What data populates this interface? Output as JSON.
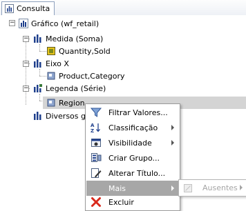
{
  "tab": {
    "label": "Consulta"
  },
  "tree": {
    "root": "Gráfico (wf_retail)",
    "measure_group": "Medida (Soma)",
    "measure_field": "Quantity,Sold",
    "xaxis_group": "Eixo X",
    "xaxis_field": "Product,Category",
    "legend_group": "Legenda (Série)",
    "legend_field": "Region",
    "misc_group": "Diversos gráficos"
  },
  "context_menu": {
    "items": [
      {
        "label": "Filtrar Valores...",
        "icon": "funnel-icon"
      },
      {
        "label": "Classificação",
        "icon": "sort-az-icon",
        "submenu": true
      },
      {
        "label": "Visibilidade",
        "icon": "visibility-icon",
        "submenu": true
      },
      {
        "label": "Criar Grupo...",
        "icon": "group-icon"
      },
      {
        "label": "Alterar Título...",
        "icon": "edit-title-icon"
      },
      {
        "label": "Mais",
        "submenu": true
      },
      {
        "label": "Excluir",
        "icon": "delete-x-icon"
      }
    ]
  },
  "submenu": {
    "label": "Ausentes"
  },
  "colors": {
    "highlight": "#d4d4d4",
    "menu_selected": "#a7a7a7",
    "delete": "#d9281a",
    "chart_blue": "#1e3f8c"
  }
}
